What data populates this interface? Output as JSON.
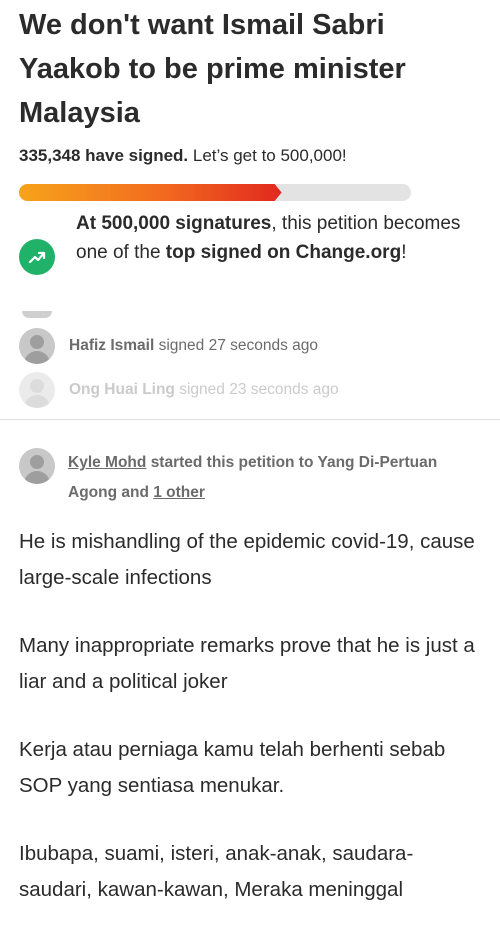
{
  "petition": {
    "title": "We don't want Ismail Sabri Yaakob to be prime minister Malaysia",
    "signed_count": "335,348 have signed.",
    "goal_text": "Let’s get to 500,000!",
    "progress_fraction": 0.67,
    "progress_colors": {
      "start": "#f7a31b",
      "end": "#e0281f",
      "track": "#e3e3e3"
    }
  },
  "milestone": {
    "icon": "trending-up-icon",
    "icon_color": "#21b26a",
    "bold_1": "At 500,000 signatures",
    "text_1": ", this petition becomes one of the ",
    "bold_2": "top signed on Change.org",
    "text_2": "!"
  },
  "recent_signers": [
    {
      "name": "Hafiz Ismail",
      "action": "signed 27 seconds ago"
    },
    {
      "name": "Ong Huai Ling",
      "action": "signed 23 seconds ago"
    }
  ],
  "starter": {
    "name": "Kyle Mohd",
    "text": "started this petition to Yang Di-Pertuan Agong and",
    "other_link": "1 other"
  },
  "body_paragraphs": [
    "He is mishandling of the epidemic covid-19, cause large-scale infections",
    "Many inappropriate remarks prove that he is just a liar and a political joker",
    "Kerja atau perniaga kamu telah berhenti sebab SOP yang sentiasa menukar.",
    "Ibubapa, suami, isteri, anak-anak, saudara-saudari, kawan-kawan, Meraka meninggal"
  ]
}
